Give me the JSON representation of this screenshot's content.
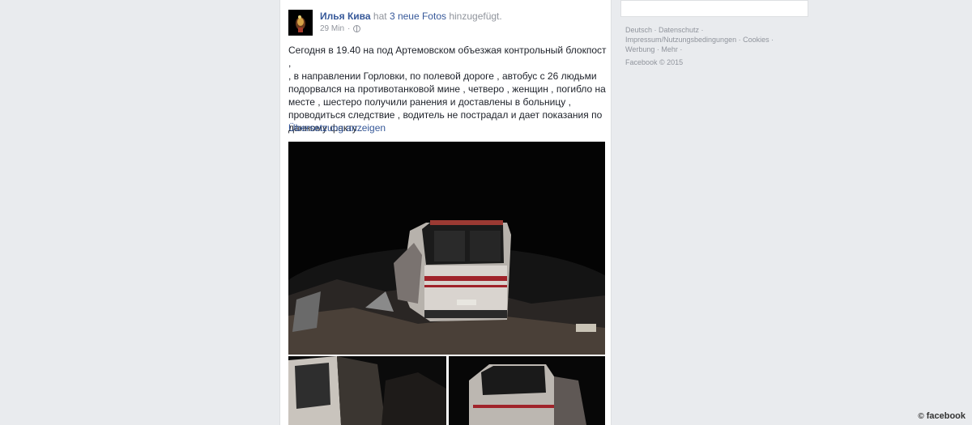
{
  "post": {
    "author": "Илья Кива",
    "action_prefix": "hat",
    "photos_link": "3 neue Fotos",
    "action_suffix": "hinzugefügt.",
    "time": "29 Min",
    "lines": [
      "Сегодня в 19.40 на под Артемовском объезжая контрольный блокпост ,",
      ", в направлении Горловки, по полевой дороге , автобус с 26 людьми",
      "подорвался на противотанковой мине , четверо , женщин , погибло на",
      "месте , шестеро получили ранения и доставлены в больницу ,",
      "проводиться следствие , водитель не пострадал и дает показания по",
      "данному факту ."
    ],
    "translate": "Übersetzung anzeigen"
  },
  "footer": {
    "line1": "Deutsch · Datenschutz ·",
    "line2": "Impressum/Nutzungsbedingungen · Cookies ·",
    "line3": "Werbung · Mehr ·",
    "copyright": "Facebook © 2015"
  },
  "credit": {
    "symbol": "©",
    "text": "facebook"
  },
  "colors": {
    "link": "#365899",
    "muted": "#90949c",
    "background": "#e9ebee"
  }
}
